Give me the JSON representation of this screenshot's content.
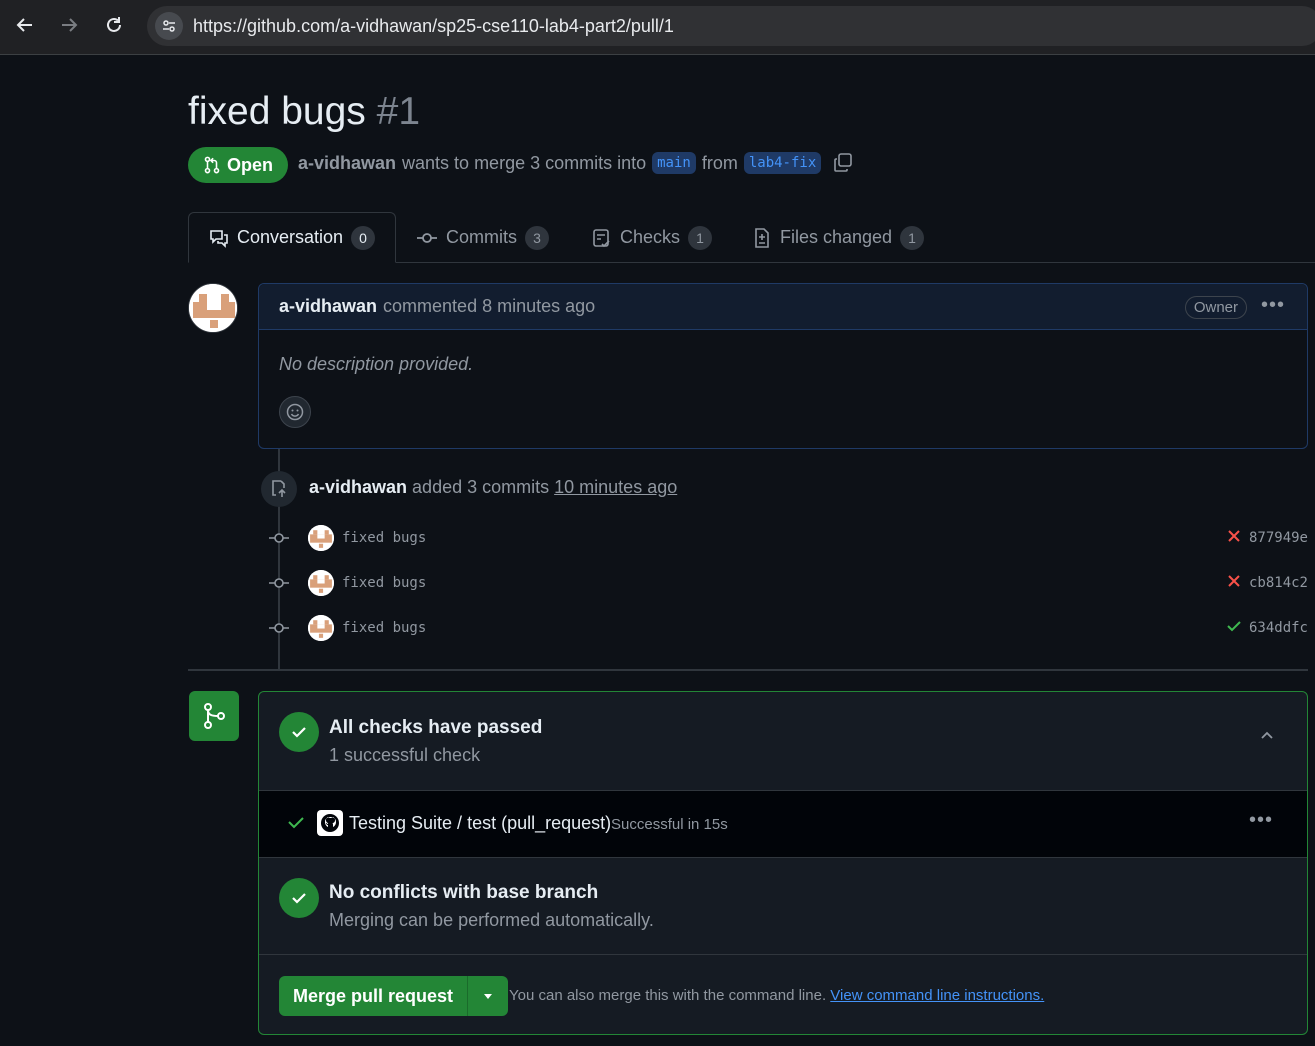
{
  "browser": {
    "url": "https://github.com/a-vidhawan/sp25-cse110-lab4-part2/pull/1"
  },
  "pr": {
    "title": "fixed bugs",
    "number": "#1",
    "state": "Open",
    "author": "a-vidhawan",
    "merge_text": "wants to merge 3 commits into",
    "base_branch": "main",
    "from_text": "from",
    "head_branch": "lab4-fix"
  },
  "tabs": [
    {
      "label": "Conversation",
      "count": "0"
    },
    {
      "label": "Commits",
      "count": "3"
    },
    {
      "label": "Checks",
      "count": "1"
    },
    {
      "label": "Files changed",
      "count": "1"
    }
  ],
  "comment": {
    "author": "a-vidhawan",
    "action": "commented 8 minutes ago",
    "role": "Owner",
    "body": "No description provided."
  },
  "push_event": {
    "author": "a-vidhawan",
    "action": "added 3 commits",
    "time": "10 minutes ago"
  },
  "commits": [
    {
      "message": "fixed bugs",
      "status": "fail",
      "sha": "877949e"
    },
    {
      "message": "fixed bugs",
      "status": "fail",
      "sha": "cb814c2"
    },
    {
      "message": "fixed bugs",
      "status": "pass",
      "sha": "634ddfc"
    }
  ],
  "merge_box": {
    "checks_title": "All checks have passed",
    "checks_sub": "1 successful check",
    "check_name": "Testing Suite / test (pull_request)",
    "check_detail": "Successful in 15s",
    "conflicts_title": "No conflicts with base branch",
    "conflicts_sub": "Merging can be performed automatically.",
    "merge_button": "Merge pull request",
    "hint_text": "You can also merge this with the command line.",
    "hint_link": "View command line instructions."
  },
  "colors": {
    "accent_green": "#238636",
    "link_blue": "#4493f8",
    "fail_red": "#f85149",
    "pass_green": "#3fb950"
  }
}
